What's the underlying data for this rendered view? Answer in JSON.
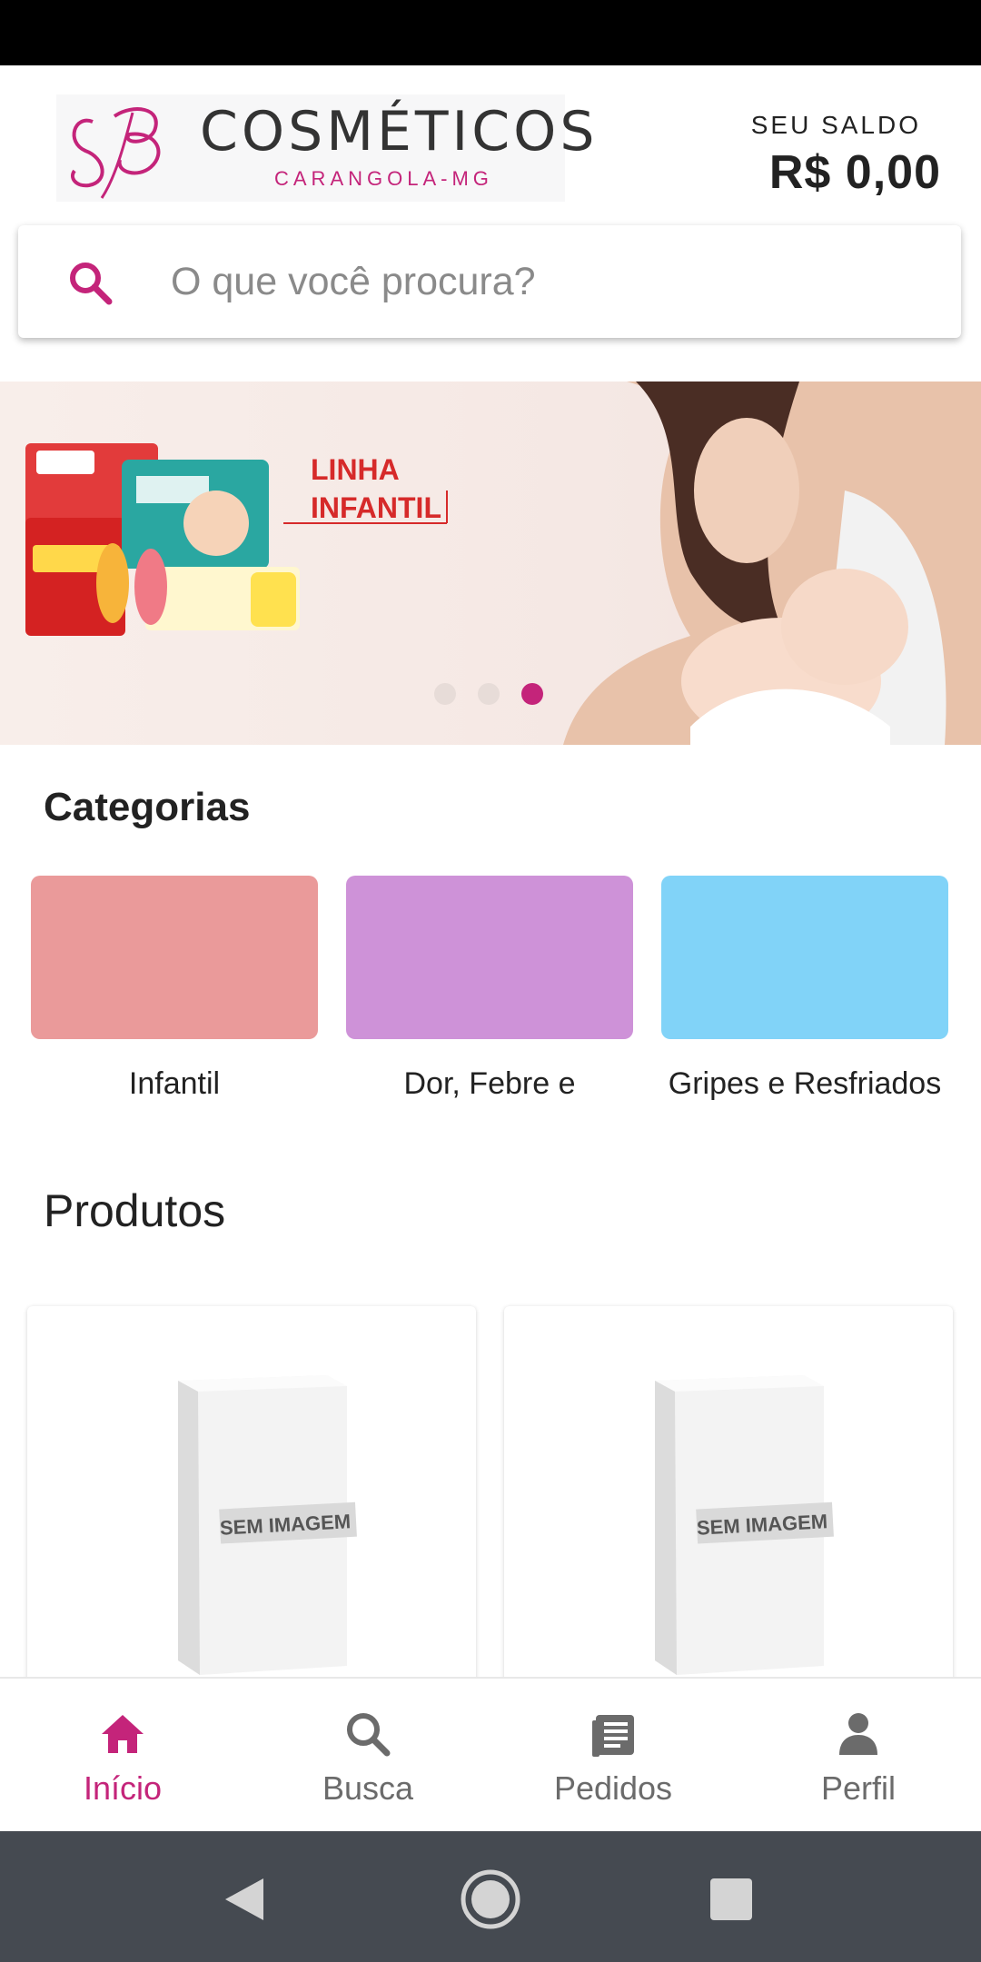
{
  "header": {
    "brand_title": "COSMÉTICOS",
    "brand_subtitle": "CARANGOLA-MG",
    "balance_label": "SEU SALDO",
    "balance_value": "R$ 0,00"
  },
  "search": {
    "placeholder": "O que você procura?"
  },
  "banner": {
    "text_line1": "LINHA",
    "text_line2": "INFANTIL",
    "slide_count": 3,
    "active_slide": 3
  },
  "categories": {
    "title": "Categorias",
    "items": [
      {
        "label": "Infantil",
        "color": "#ea9a9a"
      },
      {
        "label": "Dor, Febre e",
        "color": "#ce92d8"
      },
      {
        "label": "Gripes e Resfriados",
        "color": "#81d3f8"
      }
    ]
  },
  "products": {
    "title": "Produtos",
    "items": [
      {
        "image_label": "SEM IMAGEM"
      },
      {
        "image_label": "SEM IMAGEM"
      }
    ]
  },
  "bottom_nav": {
    "items": [
      {
        "label": "Início",
        "icon": "home-icon",
        "active": true
      },
      {
        "label": "Busca",
        "icon": "search-icon",
        "active": false
      },
      {
        "label": "Pedidos",
        "icon": "orders-icon",
        "active": false
      },
      {
        "label": "Perfil",
        "icon": "profile-icon",
        "active": false
      }
    ]
  },
  "colors": {
    "accent": "#c4247a",
    "nav_inactive": "#6b6b6b",
    "system_nav": "#454a51"
  }
}
